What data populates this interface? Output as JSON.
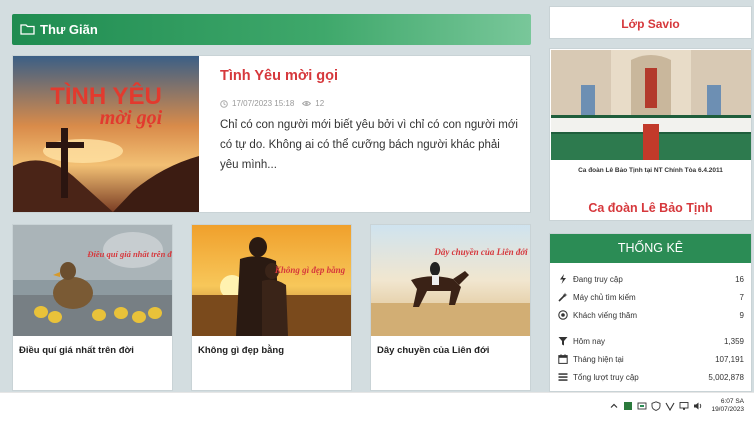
{
  "section": {
    "title": "Thư Giãn"
  },
  "featured": {
    "title": "Tình Yêu mời gọi",
    "date": "17/07/2023 15:18",
    "views": "12",
    "excerpt": "Chỉ có con người mới biết yêu bởi vì chỉ có con người mới có tự do. Không ai có thể cưỡng bách người khác phải yêu mình...",
    "image_text_line1": "TÌNH YÊU",
    "image_text_line2": "mời gọi"
  },
  "cards": [
    {
      "title": "Điều quí giá nhất trên đời",
      "image_text": "Điều quí giá nhất trên đời"
    },
    {
      "title": "Không gì đẹp bằng",
      "image_text": "Không gì đẹp bằng"
    },
    {
      "title": "Dây chuyền của Liên đới",
      "image_text": "Dây chuyền của Liên đới"
    }
  ],
  "sidebar": {
    "class_title": "Lớp Savio",
    "photo_caption": "Ca đoàn Lê Bảo Tịnh tại NT Chính Tòa 6.4.2011",
    "choir_title": "Ca đoàn Lê Bảo Tịnh"
  },
  "stats": {
    "heading": "THỐNG KÊ",
    "rows": [
      {
        "label": "Đang truy cập",
        "value": "16",
        "icon": "bolt-icon"
      },
      {
        "label": "Máy chủ tìm kiếm",
        "value": "7",
        "icon": "magic-wand-icon"
      },
      {
        "label": "Khách viếng thăm",
        "value": "9",
        "icon": "target-icon"
      },
      {
        "label": "Hôm nay",
        "value": "1,359",
        "icon": "filter-icon"
      },
      {
        "label": "Tháng hiện tại",
        "value": "107,191",
        "icon": "calendar-icon"
      },
      {
        "label": "Tổng lượt truy cập",
        "value": "5,002,878",
        "icon": "list-icon"
      }
    ]
  },
  "taskbar": {
    "time": "6:07 SA",
    "date": "19/07/2023"
  },
  "colors": {
    "green": "#2b8c55",
    "red": "#d6383c",
    "background": "#d3dde0"
  }
}
